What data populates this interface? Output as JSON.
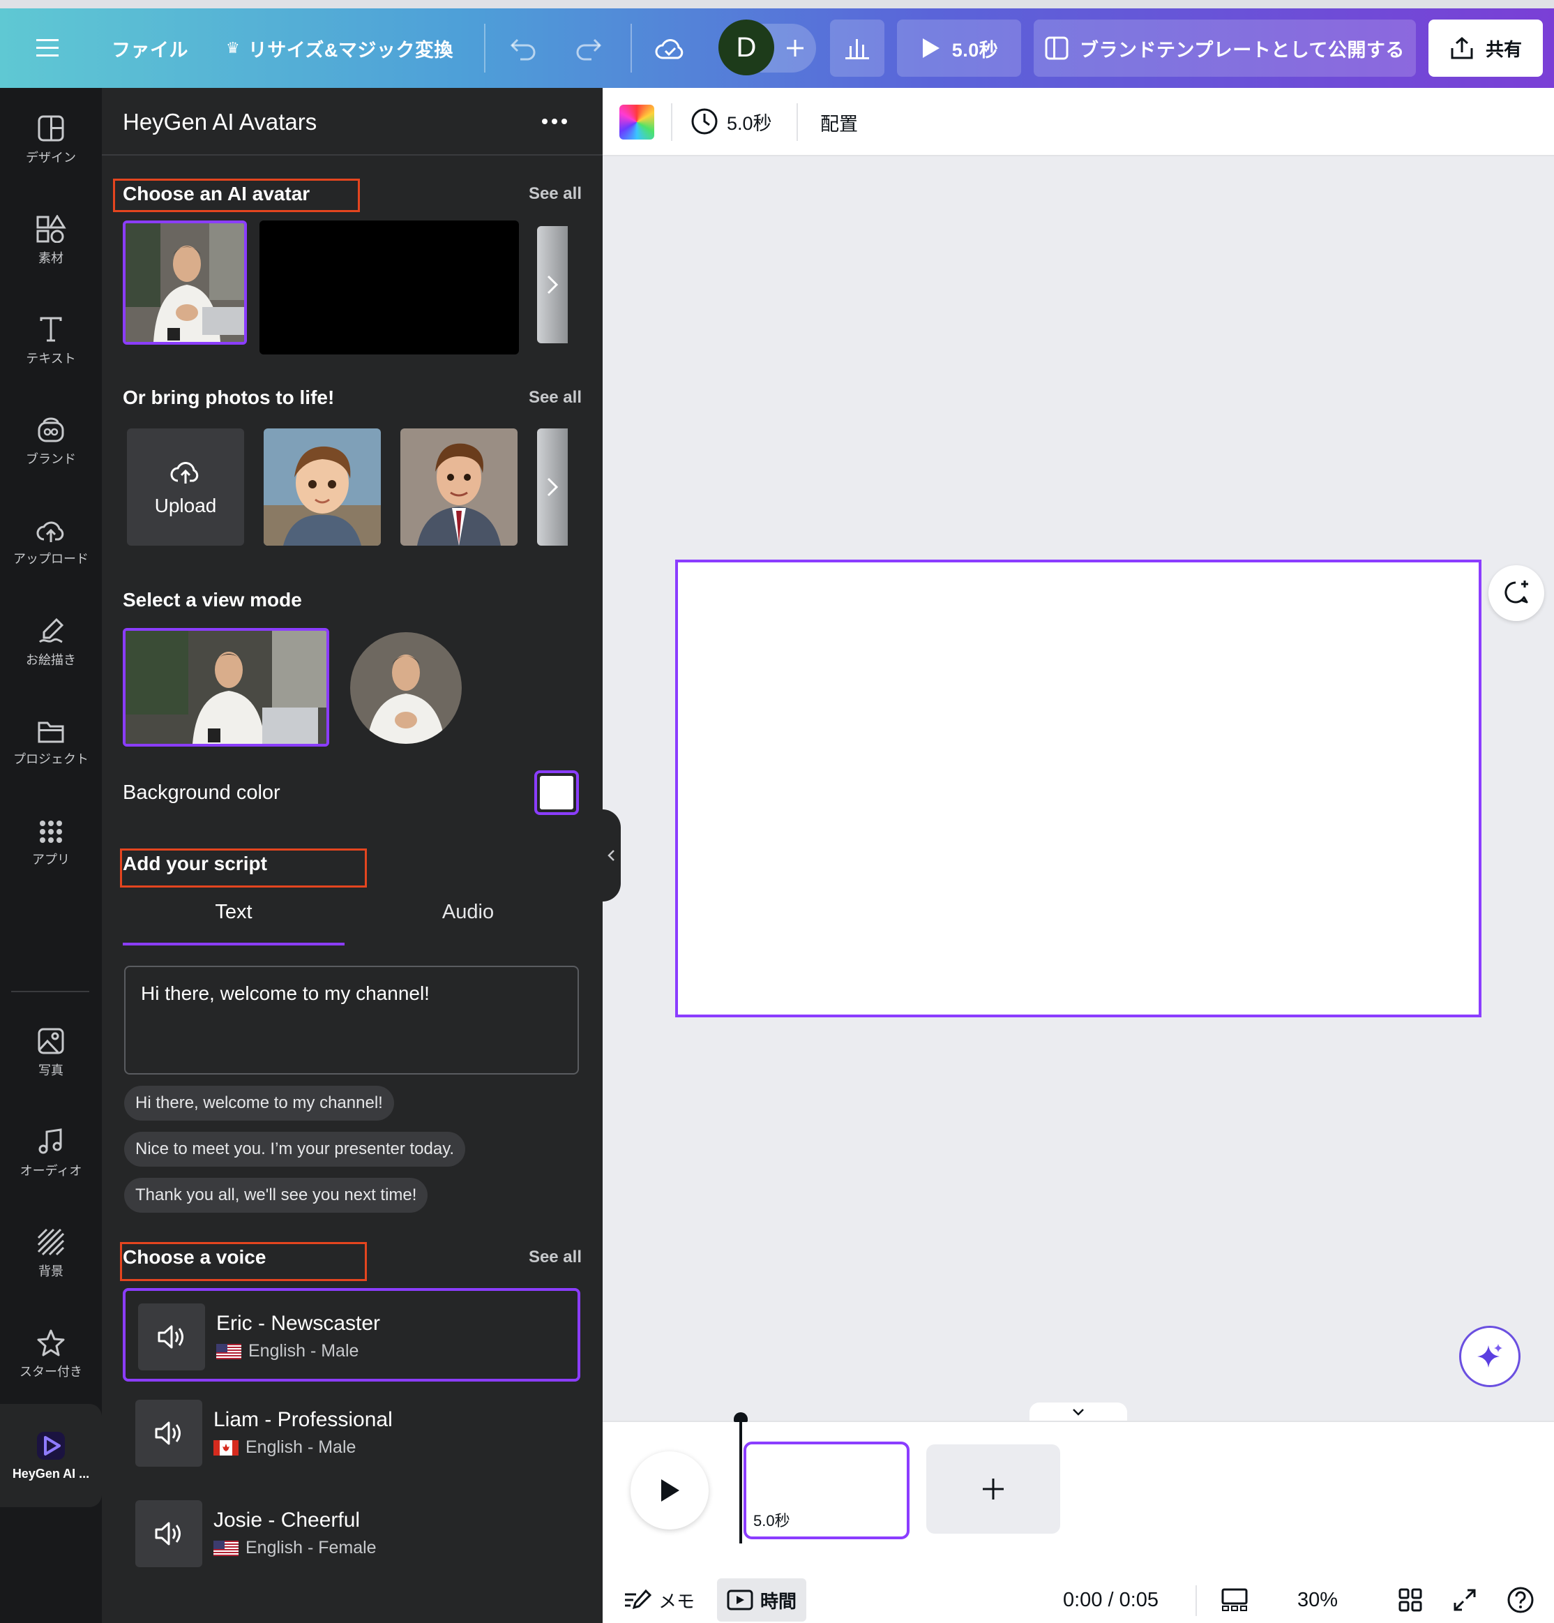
{
  "topbar": {
    "file_label": "ファイル",
    "resize_label": "リサイズ&マジック変換",
    "avatar_initial": "D",
    "play_duration": "5.0秒",
    "publish_label": "ブランドテンプレートとして公開する",
    "share_label": "共有"
  },
  "rail": {
    "items": [
      {
        "label": "デザイン",
        "icon": "layout-icon"
      },
      {
        "label": "素材",
        "icon": "shapes-icon"
      },
      {
        "label": "テキスト",
        "icon": "text-icon"
      },
      {
        "label": "ブランド",
        "icon": "brand-icon"
      },
      {
        "label": "アップロード",
        "icon": "cloud-upload-icon"
      },
      {
        "label": "お絵描き",
        "icon": "draw-icon"
      },
      {
        "label": "プロジェクト",
        "icon": "folder-icon"
      },
      {
        "label": "アプリ",
        "icon": "apps-grid-icon"
      },
      {
        "label": "写真",
        "icon": "photo-icon"
      },
      {
        "label": "オーディオ",
        "icon": "music-note-icon"
      },
      {
        "label": "背景",
        "icon": "background-stripes-icon"
      },
      {
        "label": "スター付き",
        "icon": "star-icon"
      },
      {
        "label": "HeyGen AI ...",
        "icon": "heygen-logo-icon"
      }
    ]
  },
  "panel": {
    "title": "HeyGen AI Avatars",
    "avatar_section": {
      "title": "Choose an AI avatar",
      "see_all": "See all"
    },
    "photo_section": {
      "title": "Or bring photos to life!",
      "see_all": "See all",
      "upload_label": "Upload"
    },
    "view_mode_section": {
      "title": "Select a view mode"
    },
    "background": {
      "label": "Background color",
      "value": "#ffffff"
    },
    "script_section": {
      "title": "Add your script",
      "tabs": [
        "Text",
        "Audio"
      ],
      "active_tab": "Text",
      "text_value": "Hi there, welcome to my channel!",
      "suggestions": [
        "Hi there, welcome to my channel!",
        "Nice to meet you. I’m your presenter today.",
        "Thank you all, we'll see you next time!"
      ]
    },
    "voice_section": {
      "title": "Choose a voice",
      "see_all": "See all",
      "voices": [
        {
          "name": "Eric - Newscaster",
          "lang": "English - Male",
          "flag": "us-flag-icon",
          "selected": true
        },
        {
          "name": "Liam - Professional",
          "lang": "English - Male",
          "flag": "canada-flag-icon",
          "selected": false
        },
        {
          "name": "Josie - Cheerful",
          "lang": "English - Female",
          "flag": "us-flag-icon",
          "selected": false
        }
      ]
    }
  },
  "context_bar": {
    "duration": "5.0秒",
    "position_label": "配置"
  },
  "timeline": {
    "clip_duration": "5.0秒",
    "notes_label": "メモ",
    "timing_label": "時間",
    "time_readout": "0:00 / 0:05",
    "zoom": "30%"
  },
  "colors": {
    "accent": "#8b3dff",
    "highlight_box": "#e4451f",
    "panel_bg": "#252627",
    "rail_bg": "#18191b"
  }
}
